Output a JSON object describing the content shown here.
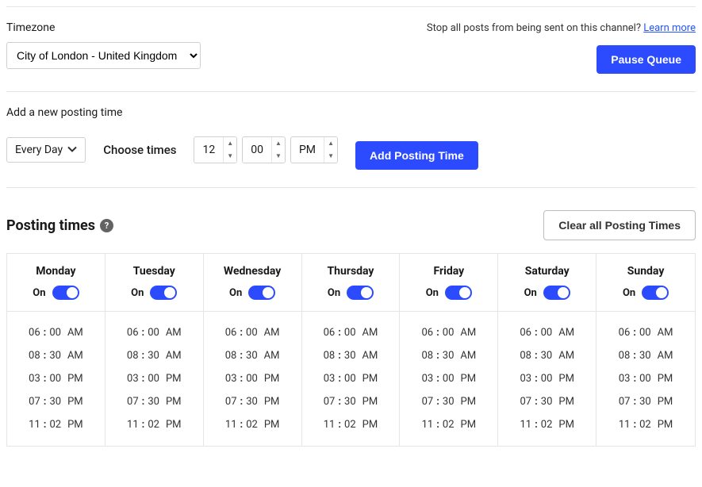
{
  "colors": {
    "primary": "#2c4bff"
  },
  "timezone": {
    "label": "Timezone",
    "value": "City of London - United Kingdom"
  },
  "pause": {
    "hint_text": "Stop all posts from being sent on this channel? ",
    "learn_more": "Learn more",
    "button_label": "Pause Queue"
  },
  "add_posting": {
    "section_label": "Add a new posting time",
    "day_select_label": "Every Day",
    "choose_times_label": "Choose times",
    "hour": "12",
    "minute": "00",
    "ampm": "PM",
    "button_label": "Add Posting Time"
  },
  "posting_times": {
    "title": "Posting times",
    "clear_button": "Clear all Posting Times",
    "toggle_state_label": "On",
    "days": [
      {
        "name": "Monday",
        "on": true
      },
      {
        "name": "Tuesday",
        "on": true
      },
      {
        "name": "Wednesday",
        "on": true
      },
      {
        "name": "Thursday",
        "on": true
      },
      {
        "name": "Friday",
        "on": true
      },
      {
        "name": "Saturday",
        "on": true
      },
      {
        "name": "Sunday",
        "on": true
      }
    ],
    "times": [
      {
        "hour": "06",
        "minute": "00",
        "ampm": "AM"
      },
      {
        "hour": "08",
        "minute": "30",
        "ampm": "AM"
      },
      {
        "hour": "03",
        "minute": "00",
        "ampm": "PM"
      },
      {
        "hour": "07",
        "minute": "30",
        "ampm": "PM"
      },
      {
        "hour": "11",
        "minute": "02",
        "ampm": "PM"
      }
    ]
  }
}
